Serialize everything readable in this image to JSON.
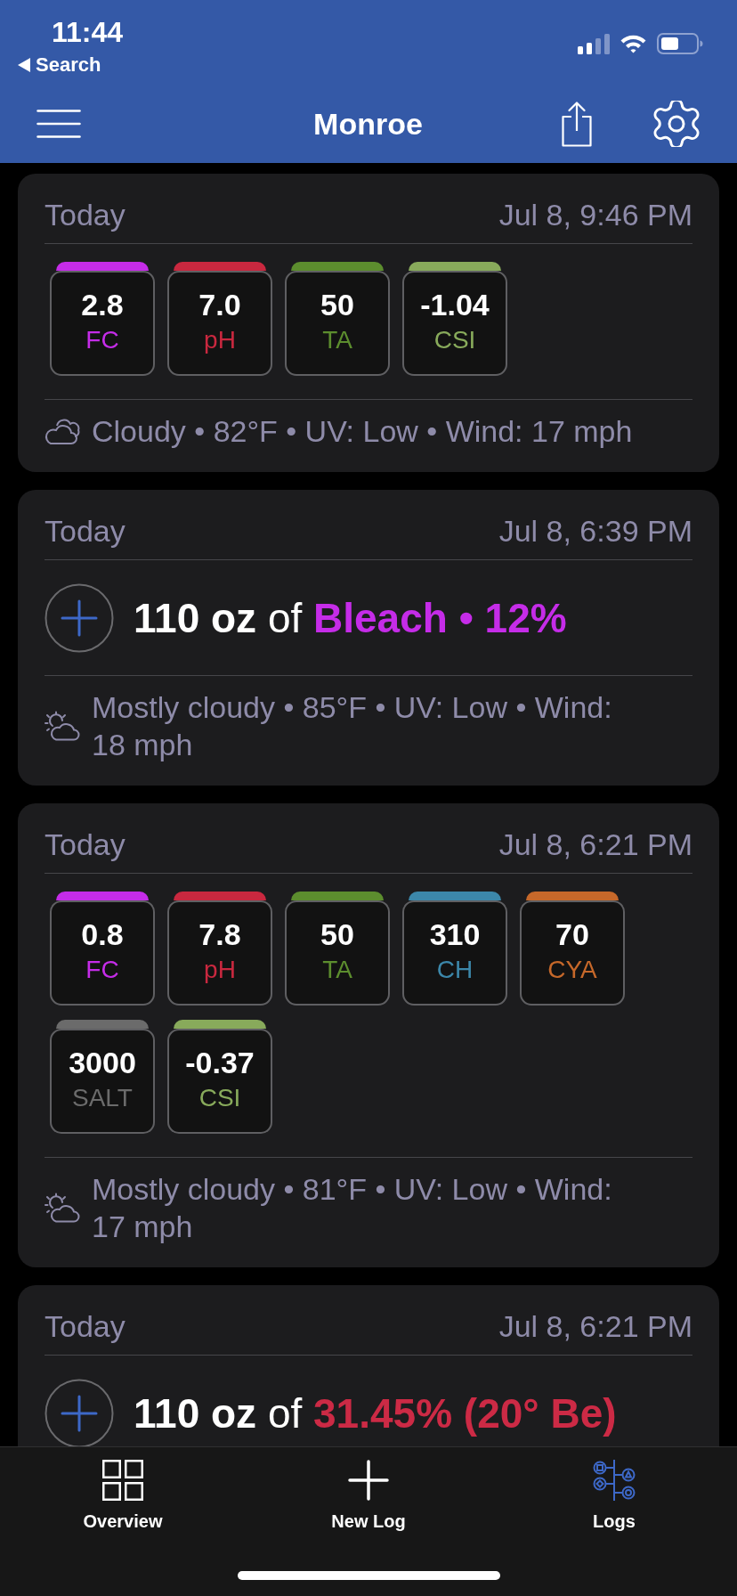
{
  "status_bar": {
    "time": "11:44",
    "back_label": "Search"
  },
  "nav": {
    "title": "Monroe"
  },
  "entries": [
    {
      "kind": "readings",
      "day": "Today",
      "time": "Jul 8, 9:46 PM",
      "readings": [
        {
          "value": "2.8",
          "label": "FC",
          "color": "#c52ce8"
        },
        {
          "value": "7.0",
          "label": "pH",
          "color": "#c9283f"
        },
        {
          "value": "50",
          "label": "TA",
          "color": "#5c8d2e"
        },
        {
          "value": "-1.04",
          "label": "CSI",
          "color": "#88aa5b"
        }
      ],
      "weather": {
        "kind": "cloudy",
        "text": "Cloudy • 82°F • UV: Low • Wind: 17 mph"
      }
    },
    {
      "kind": "dose",
      "day": "Today",
      "time": "Jul 8, 6:39 PM",
      "dose": {
        "amount": "110 oz",
        "joiner": "of",
        "chemical": "Bleach • 12%",
        "color": "#c52ce8"
      },
      "weather": {
        "kind": "partly_cloudy",
        "text": "Mostly cloudy • 85°F • UV: Low • Wind: 18 mph"
      }
    },
    {
      "kind": "readings",
      "day": "Today",
      "time": "Jul 8, 6:21 PM",
      "readings": [
        {
          "value": "0.8",
          "label": "FC",
          "color": "#c52ce8"
        },
        {
          "value": "7.8",
          "label": "pH",
          "color": "#c9283f"
        },
        {
          "value": "50",
          "label": "TA",
          "color": "#5c8d2e"
        },
        {
          "value": "310",
          "label": "CH",
          "color": "#3c87aa"
        },
        {
          "value": "70",
          "label": "CYA",
          "color": "#c6682a"
        },
        {
          "value": "3000",
          "label": "SALT",
          "color": "#6b6b6b"
        },
        {
          "value": "-0.37",
          "label": "CSI",
          "color": "#88aa5b"
        }
      ],
      "weather": {
        "kind": "partly_cloudy",
        "text": "Mostly cloudy • 81°F • UV: Low • Wind: 17 mph"
      }
    },
    {
      "kind": "dose",
      "day": "Today",
      "time": "Jul 8, 6:21 PM",
      "dose": {
        "amount": "110 oz",
        "joiner": "of",
        "chemical": "31.45% (20° Be)",
        "color": "#cc2a45"
      }
    }
  ],
  "tab_bar": [
    {
      "kind": "grid",
      "label": "Overview",
      "selected": false
    },
    {
      "kind": "plus",
      "label": "New Log",
      "selected": false
    },
    {
      "kind": "tree",
      "label": "Logs",
      "selected": true
    }
  ]
}
